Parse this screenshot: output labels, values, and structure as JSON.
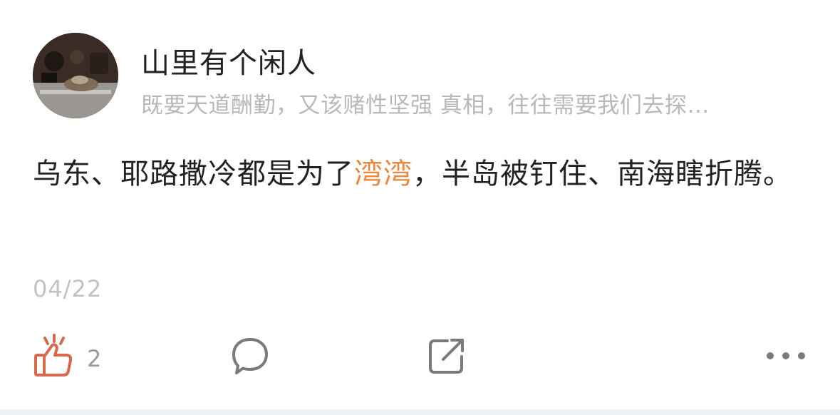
{
  "user": {
    "name": "山里有个闲人",
    "signature": "既要天道酬勤，又该赌性坚强  真相，往往需要我们去探…"
  },
  "post": {
    "text_before": "乌东、耶路撒冷都是为了",
    "topic": "湾湾",
    "text_after": "，半岛被钉住、南海瞎折腾。",
    "date": "04/22"
  },
  "actions": {
    "like_count": "2"
  },
  "colors": {
    "topic": "#e9883d",
    "like_icon": "#d9694c",
    "icon_gray": "#7a7a7a"
  },
  "icons": {
    "like": "thumbs-up-icon",
    "comment": "comment-bubble-icon",
    "share": "share-icon",
    "more": "more-dots-icon"
  }
}
